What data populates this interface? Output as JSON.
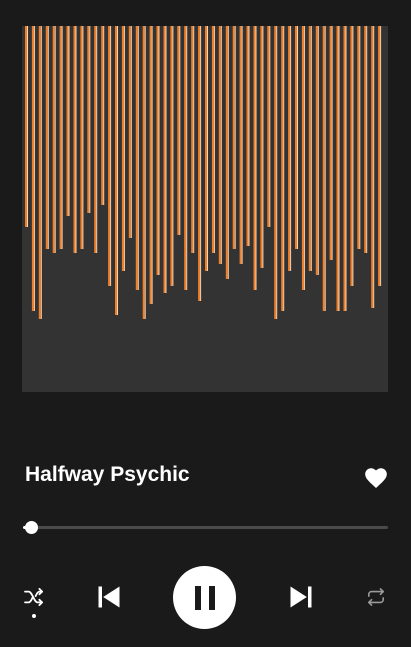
{
  "app": {
    "background_color": "#1a1a1a",
    "accent_color": "#f07f2a"
  },
  "artwork": {
    "background_color": "#333333",
    "bar_color": "#f07f2a",
    "bar_highlight_color": "#fbd3ae",
    "bar_levels": [
      0.55,
      0.78,
      0.8,
      0.61,
      0.62,
      0.61,
      0.52,
      0.62,
      0.61,
      0.51,
      0.62,
      0.49,
      0.71,
      0.79,
      0.67,
      0.58,
      0.72,
      0.8,
      0.76,
      0.68,
      0.73,
      0.71,
      0.57,
      0.72,
      0.62,
      0.75,
      0.67,
      0.62,
      0.65,
      0.69,
      0.61,
      0.65,
      0.6,
      0.72,
      0.66,
      0.55,
      0.8,
      0.78,
      0.67,
      0.61,
      0.72,
      0.67,
      0.68,
      0.78,
      0.64,
      0.78,
      0.78,
      0.71,
      0.61,
      0.62,
      0.77,
      0.71
    ]
  },
  "track": {
    "title": "Halfway Psychic",
    "liked": true
  },
  "progress": {
    "fraction": 0.02
  },
  "controls": {
    "shuffle_icon": "shuffle-icon",
    "shuffle_active": true,
    "previous_icon": "skip-previous-icon",
    "play_pause_icon": "pause-icon",
    "next_icon": "skip-next-icon",
    "repeat_icon": "repeat-icon"
  }
}
